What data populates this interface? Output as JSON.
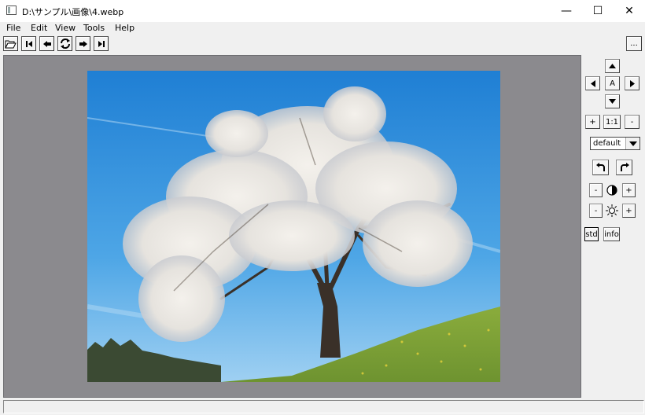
{
  "window": {
    "title": "D:\\サンプル\\画像\\4.webp",
    "minimize_glyph": "—",
    "maximize_glyph": "☐",
    "close_glyph": "✕"
  },
  "menu": [
    "File",
    "Edit",
    "View",
    "Tools",
    "Help"
  ],
  "toolbar": {
    "buttons": [
      "open-folder-icon",
      "first-image-icon",
      "previous-image-icon",
      "reload-icon",
      "next-image-icon",
      "last-image-icon"
    ],
    "more_label": "..."
  },
  "side": {
    "center_label": "A",
    "zoom_in": "+",
    "zoom_reset": "1:1",
    "zoom_out": "-",
    "filter_selected": "default",
    "contrast_minus": "-",
    "contrast_plus": "+",
    "brightness_minus": "-",
    "brightness_plus": "+",
    "std_label": "std",
    "info_label": "info"
  },
  "colors": {
    "viewport_bg": "#8b8a8e",
    "sky_top": "#2a86d6",
    "sky_bottom": "#7cc0ee",
    "grass": "#7fa43a"
  }
}
